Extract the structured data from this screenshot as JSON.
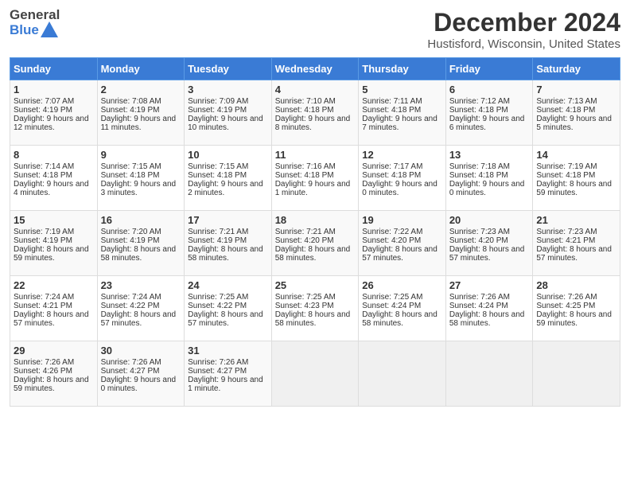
{
  "header": {
    "logo_general": "General",
    "logo_blue": "Blue",
    "title": "December 2024",
    "location": "Hustisford, Wisconsin, United States"
  },
  "days_of_week": [
    "Sunday",
    "Monday",
    "Tuesday",
    "Wednesday",
    "Thursday",
    "Friday",
    "Saturday"
  ],
  "weeks": [
    [
      {
        "day": "1",
        "sunrise": "Sunrise: 7:07 AM",
        "sunset": "Sunset: 4:19 PM",
        "daylight": "Daylight: 9 hours and 12 minutes."
      },
      {
        "day": "2",
        "sunrise": "Sunrise: 7:08 AM",
        "sunset": "Sunset: 4:19 PM",
        "daylight": "Daylight: 9 hours and 11 minutes."
      },
      {
        "day": "3",
        "sunrise": "Sunrise: 7:09 AM",
        "sunset": "Sunset: 4:19 PM",
        "daylight": "Daylight: 9 hours and 10 minutes."
      },
      {
        "day": "4",
        "sunrise": "Sunrise: 7:10 AM",
        "sunset": "Sunset: 4:18 PM",
        "daylight": "Daylight: 9 hours and 8 minutes."
      },
      {
        "day": "5",
        "sunrise": "Sunrise: 7:11 AM",
        "sunset": "Sunset: 4:18 PM",
        "daylight": "Daylight: 9 hours and 7 minutes."
      },
      {
        "day": "6",
        "sunrise": "Sunrise: 7:12 AM",
        "sunset": "Sunset: 4:18 PM",
        "daylight": "Daylight: 9 hours and 6 minutes."
      },
      {
        "day": "7",
        "sunrise": "Sunrise: 7:13 AM",
        "sunset": "Sunset: 4:18 PM",
        "daylight": "Daylight: 9 hours and 5 minutes."
      }
    ],
    [
      {
        "day": "8",
        "sunrise": "Sunrise: 7:14 AM",
        "sunset": "Sunset: 4:18 PM",
        "daylight": "Daylight: 9 hours and 4 minutes."
      },
      {
        "day": "9",
        "sunrise": "Sunrise: 7:15 AM",
        "sunset": "Sunset: 4:18 PM",
        "daylight": "Daylight: 9 hours and 3 minutes."
      },
      {
        "day": "10",
        "sunrise": "Sunrise: 7:15 AM",
        "sunset": "Sunset: 4:18 PM",
        "daylight": "Daylight: 9 hours and 2 minutes."
      },
      {
        "day": "11",
        "sunrise": "Sunrise: 7:16 AM",
        "sunset": "Sunset: 4:18 PM",
        "daylight": "Daylight: 9 hours and 1 minute."
      },
      {
        "day": "12",
        "sunrise": "Sunrise: 7:17 AM",
        "sunset": "Sunset: 4:18 PM",
        "daylight": "Daylight: 9 hours and 0 minutes."
      },
      {
        "day": "13",
        "sunrise": "Sunrise: 7:18 AM",
        "sunset": "Sunset: 4:18 PM",
        "daylight": "Daylight: 9 hours and 0 minutes."
      },
      {
        "day": "14",
        "sunrise": "Sunrise: 7:19 AM",
        "sunset": "Sunset: 4:18 PM",
        "daylight": "Daylight: 8 hours and 59 minutes."
      }
    ],
    [
      {
        "day": "15",
        "sunrise": "Sunrise: 7:19 AM",
        "sunset": "Sunset: 4:19 PM",
        "daylight": "Daylight: 8 hours and 59 minutes."
      },
      {
        "day": "16",
        "sunrise": "Sunrise: 7:20 AM",
        "sunset": "Sunset: 4:19 PM",
        "daylight": "Daylight: 8 hours and 58 minutes."
      },
      {
        "day": "17",
        "sunrise": "Sunrise: 7:21 AM",
        "sunset": "Sunset: 4:19 PM",
        "daylight": "Daylight: 8 hours and 58 minutes."
      },
      {
        "day": "18",
        "sunrise": "Sunrise: 7:21 AM",
        "sunset": "Sunset: 4:20 PM",
        "daylight": "Daylight: 8 hours and 58 minutes."
      },
      {
        "day": "19",
        "sunrise": "Sunrise: 7:22 AM",
        "sunset": "Sunset: 4:20 PM",
        "daylight": "Daylight: 8 hours and 57 minutes."
      },
      {
        "day": "20",
        "sunrise": "Sunrise: 7:23 AM",
        "sunset": "Sunset: 4:20 PM",
        "daylight": "Daylight: 8 hours and 57 minutes."
      },
      {
        "day": "21",
        "sunrise": "Sunrise: 7:23 AM",
        "sunset": "Sunset: 4:21 PM",
        "daylight": "Daylight: 8 hours and 57 minutes."
      }
    ],
    [
      {
        "day": "22",
        "sunrise": "Sunrise: 7:24 AM",
        "sunset": "Sunset: 4:21 PM",
        "daylight": "Daylight: 8 hours and 57 minutes."
      },
      {
        "day": "23",
        "sunrise": "Sunrise: 7:24 AM",
        "sunset": "Sunset: 4:22 PM",
        "daylight": "Daylight: 8 hours and 57 minutes."
      },
      {
        "day": "24",
        "sunrise": "Sunrise: 7:25 AM",
        "sunset": "Sunset: 4:22 PM",
        "daylight": "Daylight: 8 hours and 57 minutes."
      },
      {
        "day": "25",
        "sunrise": "Sunrise: 7:25 AM",
        "sunset": "Sunset: 4:23 PM",
        "daylight": "Daylight: 8 hours and 58 minutes."
      },
      {
        "day": "26",
        "sunrise": "Sunrise: 7:25 AM",
        "sunset": "Sunset: 4:24 PM",
        "daylight": "Daylight: 8 hours and 58 minutes."
      },
      {
        "day": "27",
        "sunrise": "Sunrise: 7:26 AM",
        "sunset": "Sunset: 4:24 PM",
        "daylight": "Daylight: 8 hours and 58 minutes."
      },
      {
        "day": "28",
        "sunrise": "Sunrise: 7:26 AM",
        "sunset": "Sunset: 4:25 PM",
        "daylight": "Daylight: 8 hours and 59 minutes."
      }
    ],
    [
      {
        "day": "29",
        "sunrise": "Sunrise: 7:26 AM",
        "sunset": "Sunset: 4:26 PM",
        "daylight": "Daylight: 8 hours and 59 minutes."
      },
      {
        "day": "30",
        "sunrise": "Sunrise: 7:26 AM",
        "sunset": "Sunset: 4:27 PM",
        "daylight": "Daylight: 9 hours and 0 minutes."
      },
      {
        "day": "31",
        "sunrise": "Sunrise: 7:26 AM",
        "sunset": "Sunset: 4:27 PM",
        "daylight": "Daylight: 9 hours and 1 minute."
      },
      null,
      null,
      null,
      null
    ]
  ]
}
